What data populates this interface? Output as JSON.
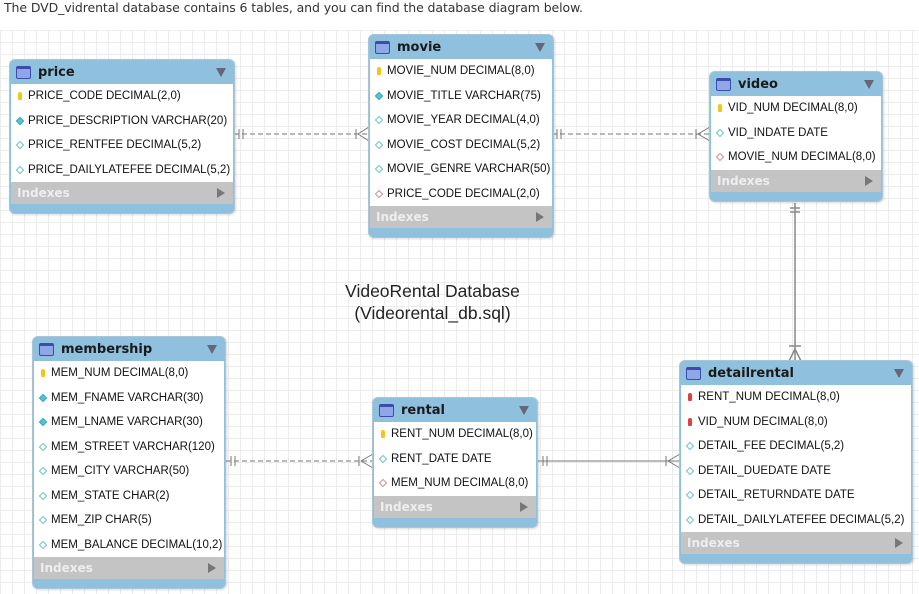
{
  "intro_text": "The DVD_vidrental database contains 6 tables, and you can find the database diagram below.",
  "diagram": {
    "caption_line1": "VideoRental Database",
    "caption_line2": "(Videorental_db.sql)",
    "indexes_label": "Indexes",
    "legend_icons": {
      "pk": "primary-key-icon",
      "fk_pk": "foreign-primary-key-icon",
      "nn": "not-null-column-icon",
      "nu": "nullable-column-icon",
      "fk": "foreign-key-column-icon"
    },
    "tables": {
      "price": {
        "name": "price",
        "columns": [
          {
            "text": "PRICE_CODE DECIMAL(2,0)",
            "kind": "pk"
          },
          {
            "text": "PRICE_DESCRIPTION VARCHAR(20)",
            "kind": "nn"
          },
          {
            "text": "PRICE_RENTFEE DECIMAL(5,2)",
            "kind": "nu"
          },
          {
            "text": "PRICE_DAILYLATEFEE DECIMAL(5,2)",
            "kind": "nu"
          }
        ]
      },
      "movie": {
        "name": "movie",
        "columns": [
          {
            "text": "MOVIE_NUM DECIMAL(8,0)",
            "kind": "pk"
          },
          {
            "text": "MOVIE_TITLE VARCHAR(75)",
            "kind": "nn"
          },
          {
            "text": "MOVIE_YEAR DECIMAL(4,0)",
            "kind": "nu"
          },
          {
            "text": "MOVIE_COST DECIMAL(5,2)",
            "kind": "nu"
          },
          {
            "text": "MOVIE_GENRE VARCHAR(50)",
            "kind": "nu"
          },
          {
            "text": "PRICE_CODE DECIMAL(2,0)",
            "kind": "fk"
          }
        ]
      },
      "video": {
        "name": "video",
        "columns": [
          {
            "text": "VID_NUM DECIMAL(8,0)",
            "kind": "pk"
          },
          {
            "text": "VID_INDATE DATE",
            "kind": "nu"
          },
          {
            "text": "MOVIE_NUM DECIMAL(8,0)",
            "kind": "fk"
          }
        ]
      },
      "membership": {
        "name": "membership",
        "columns": [
          {
            "text": "MEM_NUM DECIMAL(8,0)",
            "kind": "pk"
          },
          {
            "text": "MEM_FNAME VARCHAR(30)",
            "kind": "nn"
          },
          {
            "text": "MEM_LNAME VARCHAR(30)",
            "kind": "nn"
          },
          {
            "text": "MEM_STREET VARCHAR(120)",
            "kind": "nu"
          },
          {
            "text": "MEM_CITY VARCHAR(50)",
            "kind": "nu"
          },
          {
            "text": "MEM_STATE CHAR(2)",
            "kind": "nu"
          },
          {
            "text": "MEM_ZIP CHAR(5)",
            "kind": "nu"
          },
          {
            "text": "MEM_BALANCE DECIMAL(10,2)",
            "kind": "nu"
          }
        ]
      },
      "rental": {
        "name": "rental",
        "columns": [
          {
            "text": "RENT_NUM DECIMAL(8,0)",
            "kind": "pk"
          },
          {
            "text": "RENT_DATE DATE",
            "kind": "nu"
          },
          {
            "text": "MEM_NUM DECIMAL(8,0)",
            "kind": "fk"
          }
        ]
      },
      "detailrental": {
        "name": "detailrental",
        "columns": [
          {
            "text": "RENT_NUM DECIMAL(8,0)",
            "kind": "fk_pk"
          },
          {
            "text": "VID_NUM DECIMAL(8,0)",
            "kind": "fk_pk"
          },
          {
            "text": "DETAIL_FEE DECIMAL(5,2)",
            "kind": "nu"
          },
          {
            "text": "DETAIL_DUEDATE DATE",
            "kind": "nu"
          },
          {
            "text": "DETAIL_RETURNDATE DATE",
            "kind": "nu"
          },
          {
            "text": "DETAIL_DAILYLATEFEE DECIMAL(5,2)",
            "kind": "nu"
          }
        ]
      }
    },
    "relationships": [
      {
        "from": "price",
        "to": "movie",
        "type": "one-to-many",
        "identifying": false
      },
      {
        "from": "movie",
        "to": "video",
        "type": "one-to-many",
        "identifying": false
      },
      {
        "from": "video",
        "to": "detailrental",
        "type": "one-to-many",
        "identifying": true
      },
      {
        "from": "membership",
        "to": "rental",
        "type": "one-to-many",
        "identifying": false
      },
      {
        "from": "rental",
        "to": "detailrental",
        "type": "one-to-many",
        "identifying": true
      }
    ]
  }
}
